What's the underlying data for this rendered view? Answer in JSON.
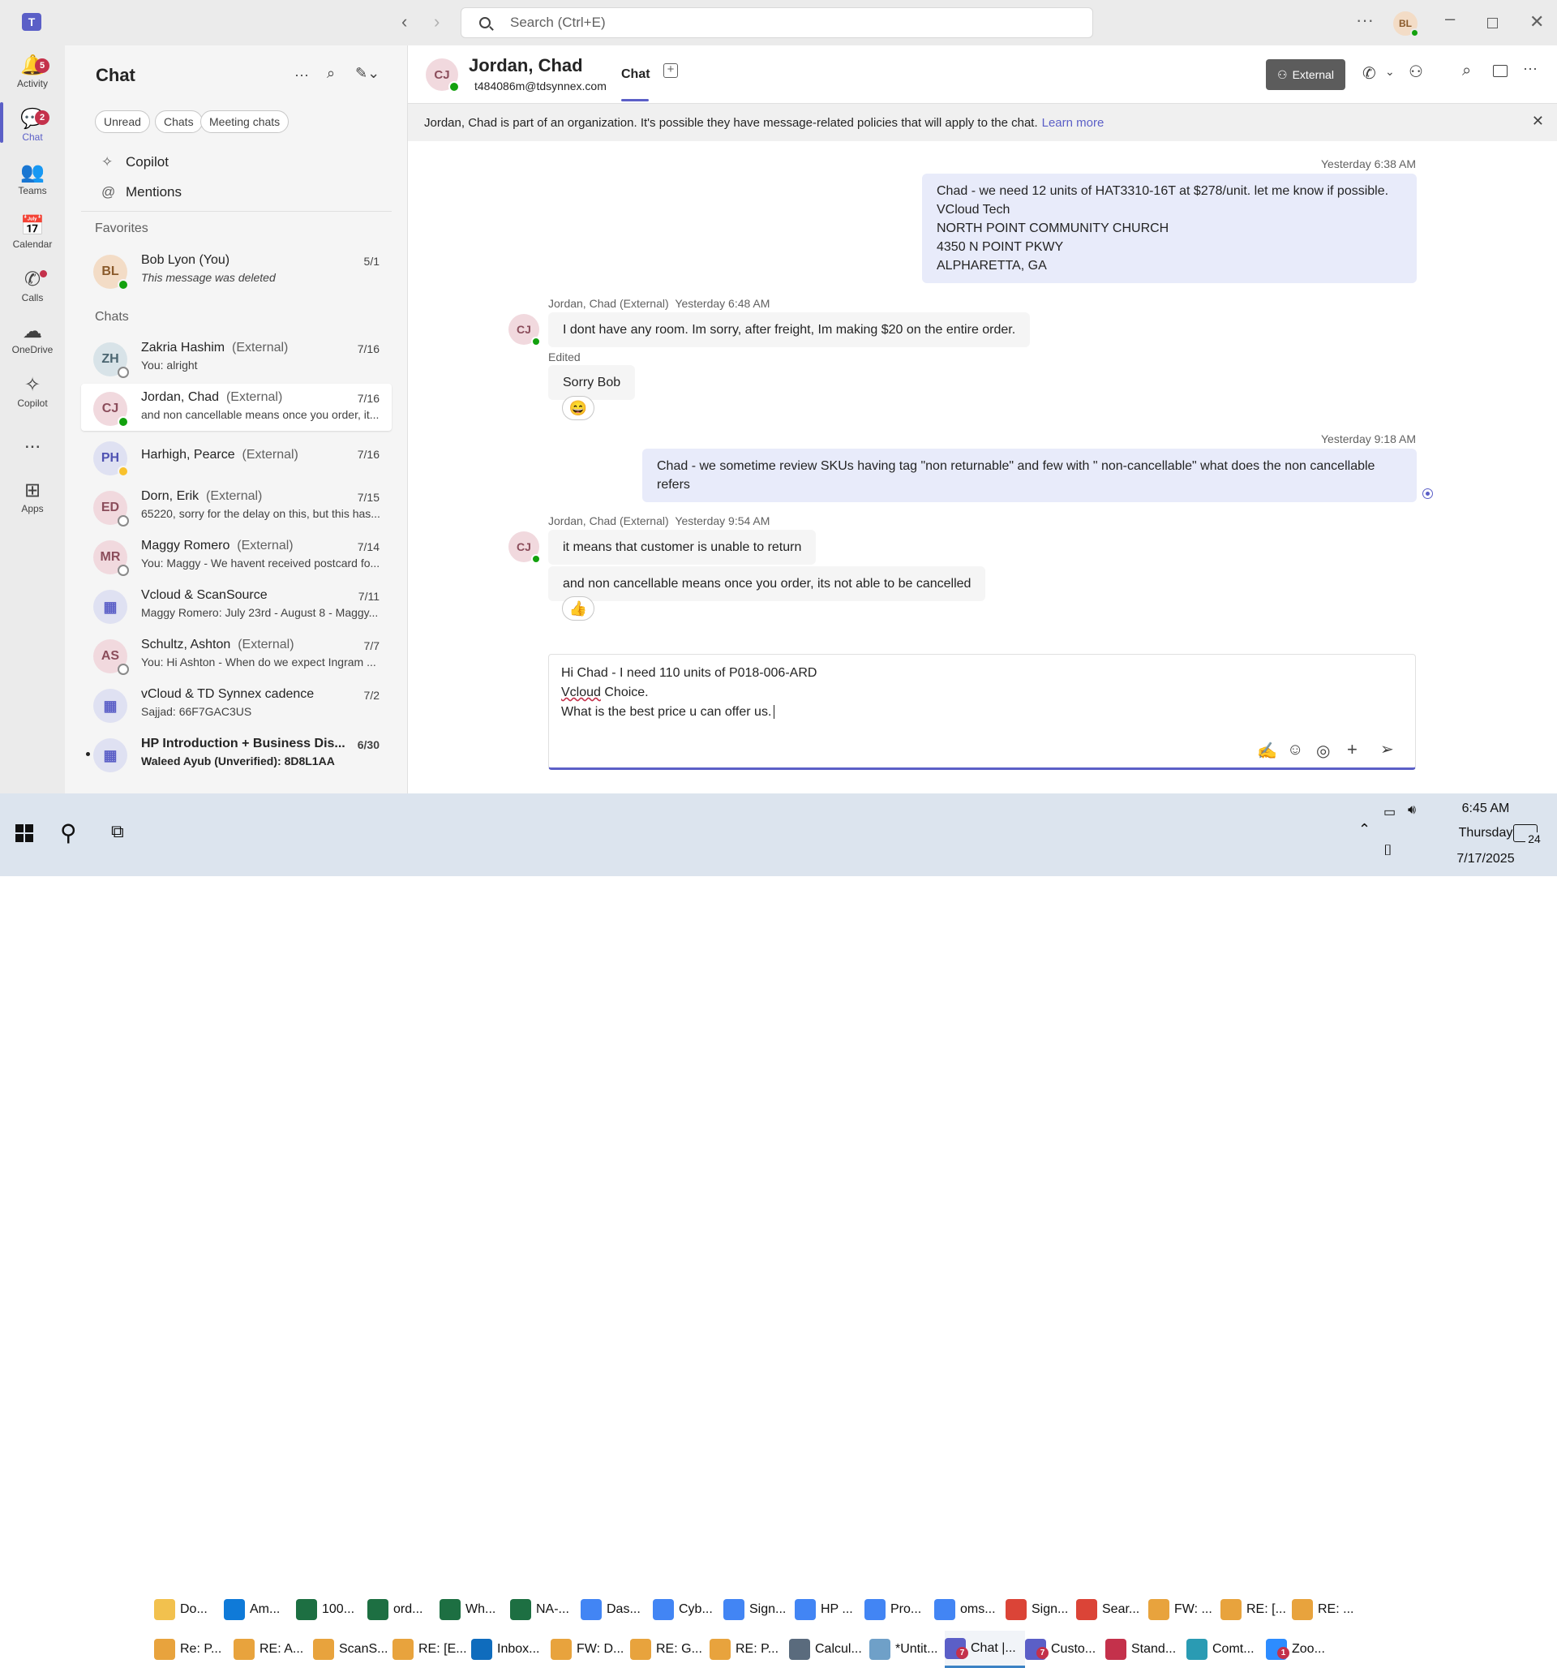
{
  "titlebar": {
    "search_placeholder": "Search (Ctrl+E)",
    "user_initials": "BL"
  },
  "rail": {
    "items": [
      {
        "label": "Activity",
        "badge": "5"
      },
      {
        "label": "Chat",
        "badge": "2"
      },
      {
        "label": "Teams"
      },
      {
        "label": "Calendar"
      },
      {
        "label": "Calls"
      },
      {
        "label": "OneDrive"
      },
      {
        "label": "Copilot"
      },
      {
        "label": "..."
      },
      {
        "label": "Apps"
      }
    ]
  },
  "list": {
    "title": "Chat",
    "filters": [
      "Unread",
      "Chats",
      "Meeting chats"
    ],
    "nav": [
      {
        "label": "Copilot",
        "icon": "copilot-icon"
      },
      {
        "label": "Mentions",
        "icon": "at-icon"
      }
    ],
    "favorites_label": "Favorites",
    "favorites": [
      {
        "initials": "BL",
        "name": "Bob Lyon (You)",
        "preview": "This message was deleted",
        "date": "5/1"
      }
    ],
    "chats_label": "Chats",
    "chats": [
      {
        "initials": "ZH",
        "name": "Zakria Hashim",
        "ext": "(External)",
        "preview": "You: alright",
        "date": "7/16"
      },
      {
        "initials": "CJ",
        "name": "Jordan, Chad",
        "ext": "(External)",
        "preview": "and non cancellable means once you order, it...",
        "date": "7/16"
      },
      {
        "initials": "PH",
        "name": "Harhigh, Pearce",
        "ext": "(External)",
        "preview": "",
        "date": "7/16"
      },
      {
        "initials": "ED",
        "name": "Dorn, Erik",
        "ext": "(External)",
        "preview": "65220, sorry for the delay on this, but this has...",
        "date": "7/15"
      },
      {
        "initials": "MR",
        "name": "Maggy Romero",
        "ext": "(External)",
        "preview": "You: Maggy - We havent received postcard fo...",
        "date": "7/14"
      },
      {
        "initials": "",
        "name": "Vcloud & ScanSource",
        "ext": "",
        "preview": "Maggy Romero: July 23rd - August 8 - Maggy...",
        "date": "7/11"
      },
      {
        "initials": "AS",
        "name": "Schultz, Ashton",
        "ext": "(External)",
        "preview": "You: Hi Ashton -  When do we expect Ingram ...",
        "date": "7/7"
      },
      {
        "initials": "",
        "name": "vCloud & TD Synnex cadence",
        "ext": "",
        "preview": "Sajjad: 66F7GAC3US",
        "date": "7/2"
      },
      {
        "initials": "",
        "name": "HP Introduction + Business Dis...",
        "ext": "",
        "preview": "Waleed Ayub (Unverified): 8D8L1AA",
        "date": "6/30"
      }
    ]
  },
  "header": {
    "initials": "CJ",
    "name": "Jordan, Chad",
    "email": "t484086m@tdsynnex.com",
    "tab": "Chat",
    "external_label": "External"
  },
  "banner": {
    "text": "Jordan, Chad is part of an organization. It's possible they have message-related policies that will apply to the chat.",
    "link": "Learn more"
  },
  "messages": {
    "ts1": "Yesterday 6:38 AM",
    "me1": [
      "Chad -  we need 12 units of HAT3310-16T at $278/unit. let me know if possible.",
      "VCloud Tech",
      "NORTH POINT COMMUNITY CHURCH",
      "4350 N POINT PKWY",
      "ALPHARETTA, GA"
    ],
    "sender1": "Jordan, Chad (External)",
    "ts2": "Yesterday 6:48 AM",
    "them1": "I dont have any room.  Im sorry, after freight, Im making $20 on the entire order.",
    "edited": "Edited",
    "them2": "Sorry Bob",
    "react1": "😄",
    "ts3": "Yesterday 9:18 AM",
    "me2": "Chad -  we sometime review SKUs having tag \"non returnable\" and few with \" non-cancellable\" what does the non cancellable refers",
    "sender2": "Jordan, Chad (External)",
    "ts4": "Yesterday 9:54 AM",
    "them3": "it means that customer is unable to return",
    "them4": "and non cancellable means once you order, its not able to be cancelled",
    "react2": "👍"
  },
  "compose": {
    "line1": "Hi Chad -  I need 110 units of P018-006-ARD",
    "line2a": "Vcloud",
    "line2b": " Choice.",
    "line3": "What is the best price u can offer us."
  },
  "taskbar": {
    "row1": [
      {
        "label": "Do...",
        "color": "#f2c14e"
      },
      {
        "label": "Am...",
        "color": "#0f7ad8"
      },
      {
        "label": "100...",
        "color": "#1d6f42"
      },
      {
        "label": "ord...",
        "color": "#1d6f42"
      },
      {
        "label": "Wh...",
        "color": "#1d6f42"
      },
      {
        "label": "NA-...",
        "color": "#1d6f42"
      },
      {
        "label": "Das...",
        "color": "#4285f4"
      },
      {
        "label": "Cyb...",
        "color": "#4285f4"
      },
      {
        "label": "Sign...",
        "color": "#4285f4"
      },
      {
        "label": "HP ...",
        "color": "#4285f4"
      },
      {
        "label": "Pro...",
        "color": "#4285f4"
      },
      {
        "label": "oms...",
        "color": "#4285f4"
      },
      {
        "label": "Sign...",
        "color": "#db4437"
      },
      {
        "label": "Sear...",
        "color": "#db4437"
      },
      {
        "label": "FW: ...",
        "color": "#e8a33d"
      },
      {
        "label": "RE: [...",
        "color": "#e8a33d"
      },
      {
        "label": "RE: ...",
        "color": "#e8a33d"
      }
    ],
    "row2": [
      {
        "label": "Re: P...",
        "color": "#e8a33d"
      },
      {
        "label": "RE: A...",
        "color": "#e8a33d"
      },
      {
        "label": "ScanS...",
        "color": "#e8a33d"
      },
      {
        "label": "RE: [E...",
        "color": "#e8a33d"
      },
      {
        "label": "Inbox...",
        "color": "#0f6cbd"
      },
      {
        "label": "FW: D...",
        "color": "#e8a33d"
      },
      {
        "label": "RE: G...",
        "color": "#e8a33d"
      },
      {
        "label": "RE: P...",
        "color": "#e8a33d"
      },
      {
        "label": "Calcul...",
        "color": "#5a6b7d"
      },
      {
        "label": "*Untit...",
        "color": "#6fa0c8"
      },
      {
        "label": "Chat |...",
        "color": "#5b5fc7"
      },
      {
        "label": "Custo...",
        "color": "#5b5fc7"
      },
      {
        "label": "Stand...",
        "color": "#c4314b"
      },
      {
        "label": "Comt...",
        "color": "#2a9bb3"
      },
      {
        "label": "Zoo...",
        "color": "#2d8cff"
      }
    ],
    "time": "6:45 AM",
    "day": "Thursday",
    "date": "7/17/2025",
    "notif_count": "24",
    "teams_badge": "7",
    "zoom_badge": "1"
  }
}
